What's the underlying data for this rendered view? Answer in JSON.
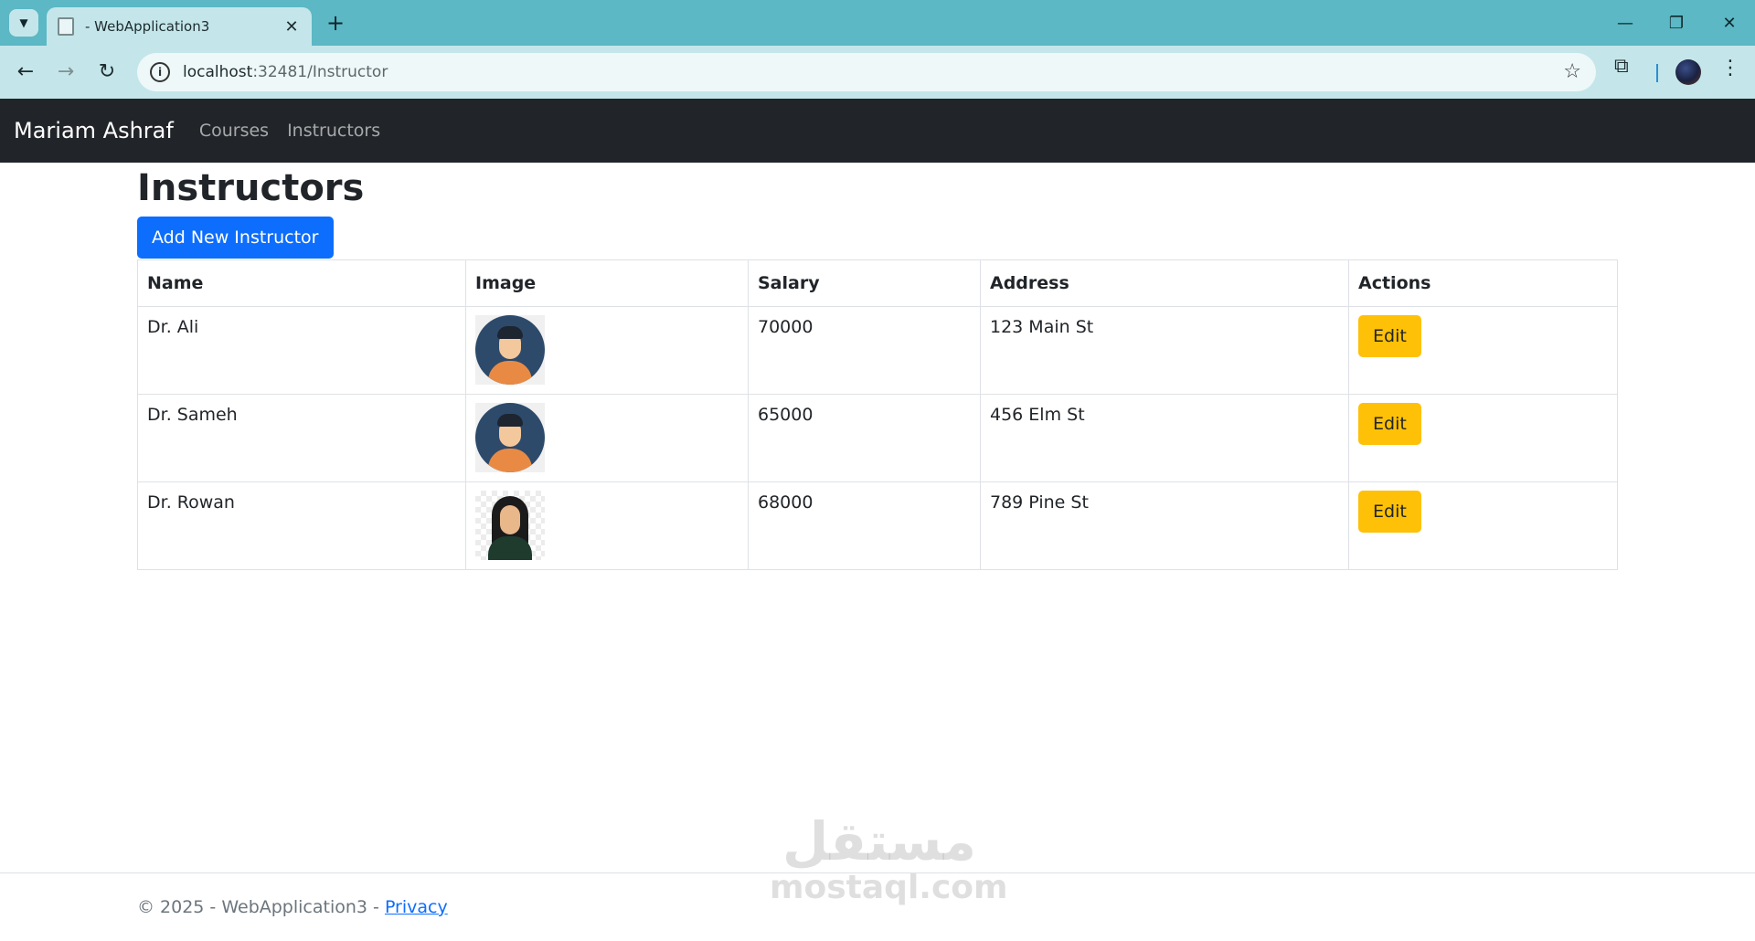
{
  "browser": {
    "tab_title": "- WebApplication3",
    "url_host": "localhost",
    "url_path": ":32481/Instructor"
  },
  "navbar": {
    "brand": "Mariam Ashraf",
    "links": [
      "Courses",
      "Instructors"
    ]
  },
  "page": {
    "title": "Instructors",
    "add_button": "Add New Instructor"
  },
  "table": {
    "headers": [
      "Name",
      "Image",
      "Salary",
      "Address",
      "Actions"
    ],
    "rows": [
      {
        "name": "Dr. Ali",
        "salary": "70000",
        "address": "123 Main St",
        "action": "Edit"
      },
      {
        "name": "Dr. Sameh",
        "salary": "65000",
        "address": "456 Elm St",
        "action": "Edit"
      },
      {
        "name": "Dr. Rowan",
        "salary": "68000",
        "address": "789 Pine St",
        "action": "Edit"
      }
    ]
  },
  "footer": {
    "text": "© 2025 - WebApplication3 - ",
    "privacy": "Privacy"
  },
  "watermark": {
    "arabic": "مستقل",
    "latin": "mostaql.com"
  },
  "colors": {
    "tabstrip": "#5bb8c4",
    "navbar": "#212529",
    "primary": "#0d6efd",
    "warning": "#ffc107"
  }
}
